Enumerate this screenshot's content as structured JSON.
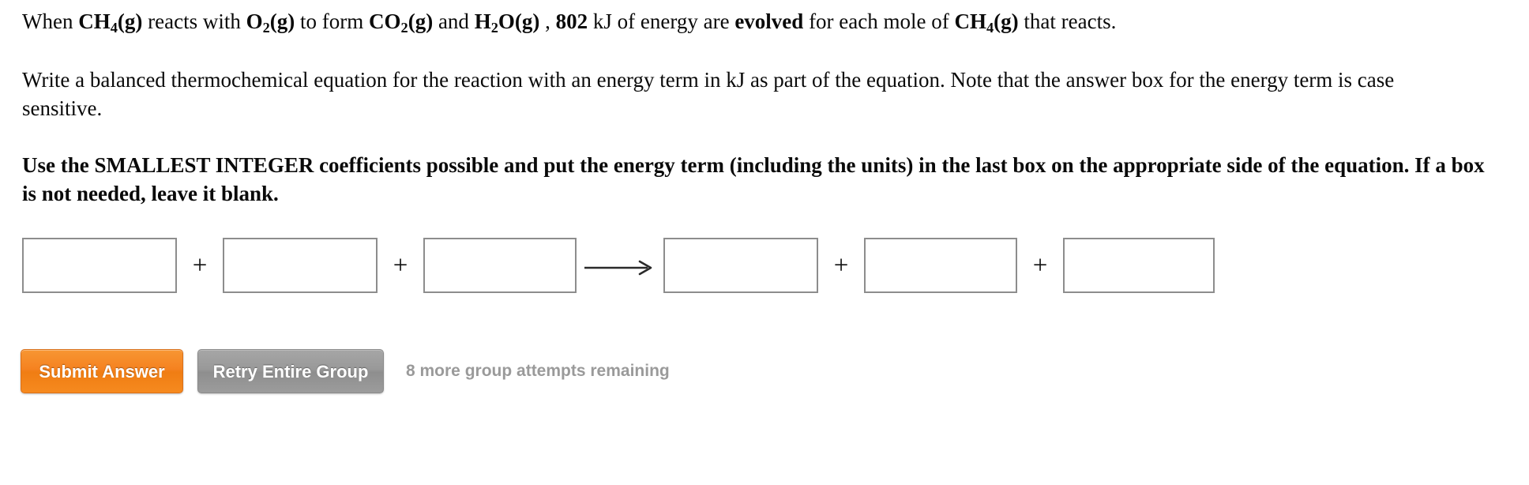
{
  "question": {
    "intro": {
      "segments": [
        {
          "text": "When ",
          "bold": false
        },
        {
          "text": "CH4(g)",
          "bold": true,
          "formula": true,
          "base": "CH",
          "sub": "4",
          "tail": "(g)"
        },
        {
          "text": " reacts with ",
          "bold": false
        },
        {
          "text": "O2(g)",
          "bold": true,
          "formula": true,
          "base": "O",
          "sub": "2",
          "tail": "(g)"
        },
        {
          "text": " to form ",
          "bold": false
        },
        {
          "text": "CO2(g)",
          "bold": true,
          "formula": true,
          "base": "CO",
          "sub": "2",
          "tail": "(g)"
        },
        {
          "text": " and ",
          "bold": false
        },
        {
          "text": "H2O(g)",
          "bold": true,
          "formula": true,
          "base": "H",
          "sub": "2",
          "tail": "O(g)"
        },
        {
          "text": " , ",
          "bold": false
        },
        {
          "text": "802",
          "bold": true
        },
        {
          "text": " kJ of energy are ",
          "bold": false
        },
        {
          "text": "evolved",
          "bold": true
        },
        {
          "text": " for each mole of ",
          "bold": false
        },
        {
          "text": "CH4(g)",
          "bold": true,
          "formula": true,
          "base": "CH",
          "sub": "4",
          "tail": "(g)"
        },
        {
          "text": " that reacts.",
          "bold": false
        }
      ],
      "plain": "When CH4(g) reacts with O2(g) to form CO2(g) and H2O(g) , 802 kJ of energy are evolved for each mole of CH4(g) that reacts.",
      "lead": "When ",
      "f1_base": "CH",
      "f1_sub": "4",
      "f1_tail": "(g)",
      "t1": " reacts with ",
      "f2_base": "O",
      "f2_sub": "2",
      "f2_tail": "(g)",
      "t2": " to form ",
      "f3_base": "CO",
      "f3_sub": "2",
      "f3_tail": "(g)",
      "t3": " and ",
      "f4_base": "H",
      "f4_sub": "2",
      "f4_tail": "O(g)",
      "t4": " , ",
      "energy_value": "802",
      "t5": " kJ of energy are ",
      "direction": "evolved",
      "t6": " for each mole of ",
      "f5_base": "CH",
      "f5_sub": "4",
      "f5_tail": "(g)",
      "t7": " that reacts."
    },
    "instructions": "Write a balanced thermochemical equation for the reaction with an energy term in kJ as part of the equation. Note that the answer box for the energy term is case sensitive.",
    "emphasis": "Use the SMALLEST INTEGER coefficients possible and put the energy term (including the units) in the last box on the appropriate side of the equation. If a box is not needed, leave it blank."
  },
  "equation": {
    "reactant_boxes": [
      {
        "value": "",
        "placeholder": ""
      },
      {
        "value": "",
        "placeholder": ""
      },
      {
        "value": "",
        "placeholder": ""
      }
    ],
    "product_boxes": [
      {
        "value": "",
        "placeholder": ""
      },
      {
        "value": "",
        "placeholder": ""
      },
      {
        "value": "",
        "placeholder": ""
      }
    ],
    "plus_symbol": "+",
    "arrow_symbol": "⟶",
    "arrow_icon": "right-arrow-icon",
    "box_border_color": "#8d8d8d"
  },
  "actions": {
    "submit_label": "Submit Answer",
    "retry_label": "Retry Entire Group",
    "attempts_text": "8 more group attempts remaining",
    "submit_color": "#f58220",
    "retry_color": "#999999",
    "attempts_color": "#9a9a9a"
  }
}
